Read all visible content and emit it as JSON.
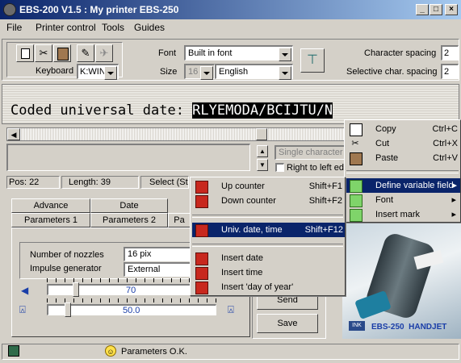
{
  "window": {
    "title": "EBS-200 V1.5 : My printer EBS-250"
  },
  "menubar": [
    "File",
    "Printer control",
    "Tools",
    "Guides"
  ],
  "toolbar": {
    "font_label": "Font",
    "font_value": "Built in font",
    "keyboard_label": "Keyboard",
    "keyboard_value": "K:WIN",
    "size_label": "Size",
    "size_value": "16",
    "language_value": "English",
    "char_spacing_label": "Character spacing",
    "char_spacing_value": "2",
    "sel_char_spacing_label": "Selective char. spacing",
    "sel_char_spacing_value": "2"
  },
  "editor": {
    "text": "Coded universal date: ",
    "selected": "RLYEMODA/BCIJTU/N"
  },
  "options": {
    "single_char": "Single character",
    "right_to_left": "Right to left ed"
  },
  "status": {
    "pos": "Pos: 22",
    "length": "Length: 39",
    "select": "Select (St"
  },
  "tabs": {
    "row1": [
      "Advance",
      "Date"
    ],
    "row2": [
      "Parameters 1",
      "Parameters 2",
      "Pa"
    ]
  },
  "params": {
    "nozzles_label": "Number of nozzles",
    "nozzles_value": "16 pix",
    "impulse_label": "Impulse generator",
    "impulse_value": "External",
    "slider1_value": "70",
    "slider2_value": "50.0"
  },
  "buttons": {
    "send": "Send",
    "save": "Save"
  },
  "statusbar": {
    "message": "Parameters O.K."
  },
  "product": {
    "caption": "EBS-250  HANDJET",
    "logo": "INK"
  },
  "context_menu": [
    {
      "label": "Copy",
      "key": "Ctrl+C"
    },
    {
      "label": "Cut",
      "key": "Ctrl+X"
    },
    {
      "label": "Paste",
      "key": "Ctrl+V"
    },
    {
      "label": "Define variable field",
      "key": ""
    },
    {
      "label": "Font",
      "key": ""
    },
    {
      "label": "Insert mark",
      "key": ""
    }
  ],
  "submenu": [
    {
      "label": "Up counter",
      "key": "Shift+F1"
    },
    {
      "label": "Down counter",
      "key": "Shift+F2"
    },
    {
      "label": "Univ. date, time",
      "key": "Shift+F12"
    },
    {
      "label": "Insert date",
      "key": ""
    },
    {
      "label": "Insert time",
      "key": ""
    },
    {
      "label": "Insert 'day of year'",
      "key": ""
    }
  ]
}
